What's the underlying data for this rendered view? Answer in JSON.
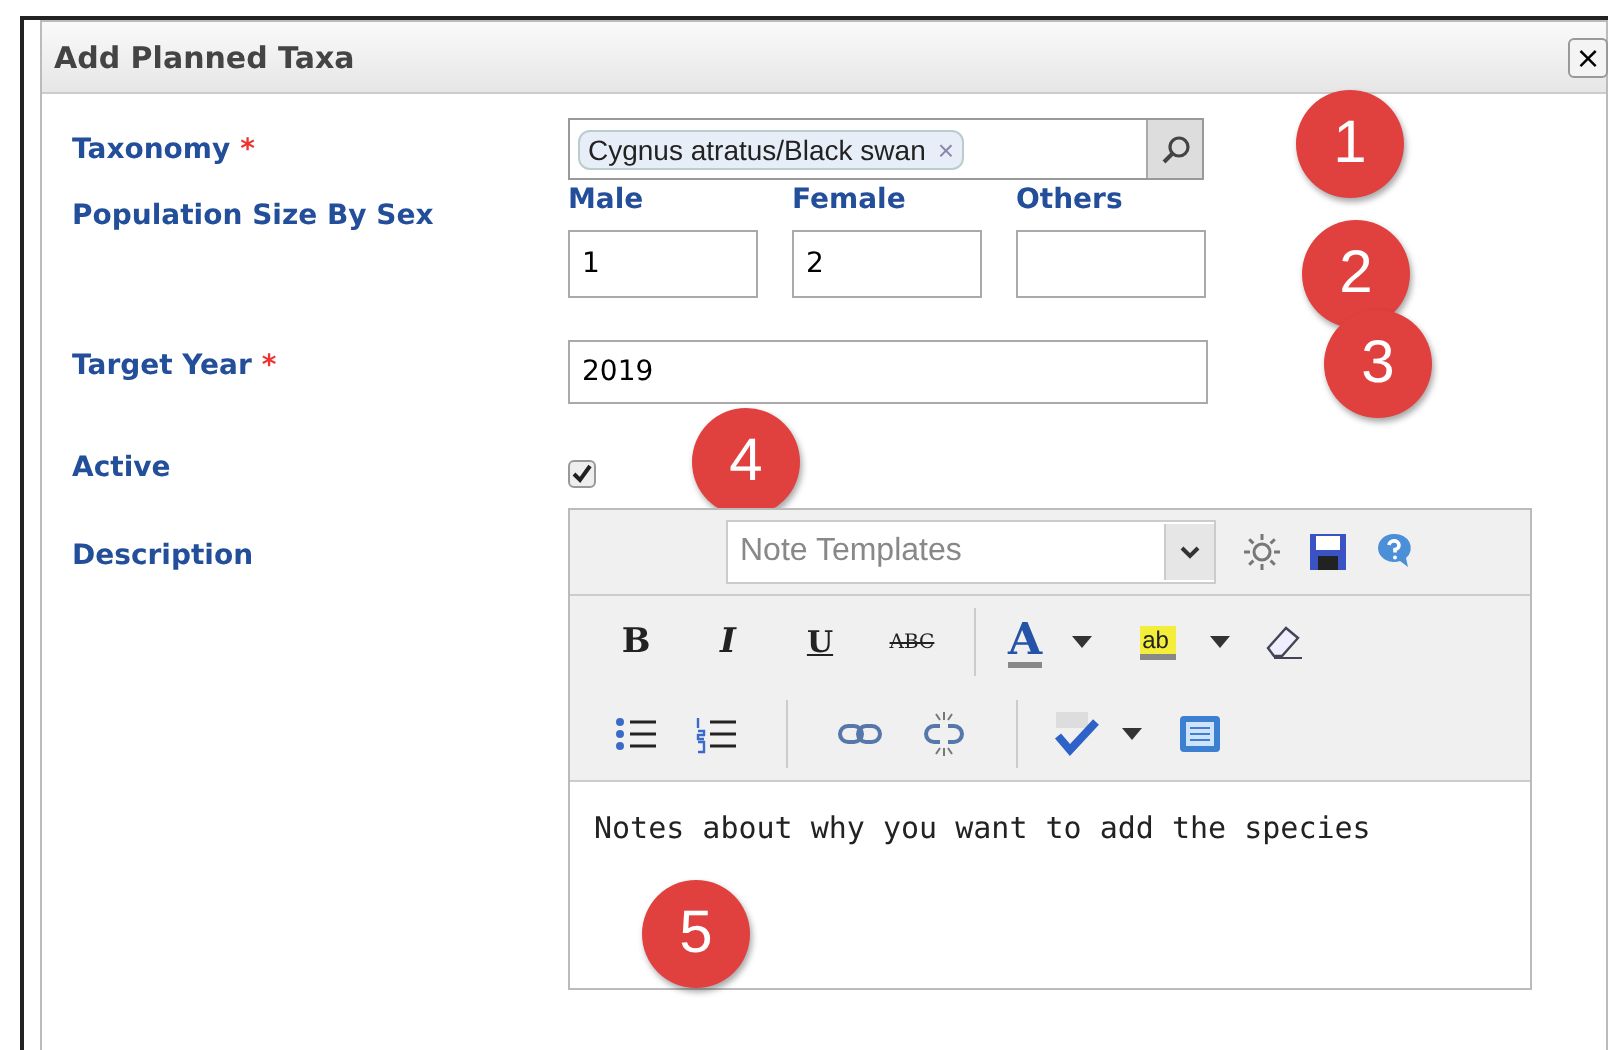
{
  "dialog": {
    "title": "Add Planned Taxa",
    "close": "×"
  },
  "fields": [
    {
      "kind": "tag",
      "label": "Taxonomy",
      "required_mark": "*",
      "tag": "Cygnus atratus/Black swan",
      "tag_remove": "×",
      "callout": "1"
    },
    {
      "kind": "triple",
      "label": "Population Size By Sex",
      "callout": "2",
      "inputs": [
        {
          "label": "Male",
          "value": "1"
        },
        {
          "label": "Female",
          "value": "2"
        },
        {
          "label": "Others"
        }
      ]
    },
    {
      "kind": "text",
      "label": "Target Year",
      "required_mark": "*",
      "value": "2019",
      "callout": "3"
    },
    {
      "kind": "check",
      "label": "Active",
      "checked": true,
      "callout": "4"
    },
    {
      "kind": "editor",
      "label": "Description",
      "callout": "5"
    }
  ],
  "editor": {
    "template_placeholder": "Note Templates",
    "format_buttons": [
      "B",
      "I",
      "U",
      "ABC"
    ],
    "font_color": "A",
    "highlight": "ab",
    "text": "Notes about why you want to add the species"
  }
}
